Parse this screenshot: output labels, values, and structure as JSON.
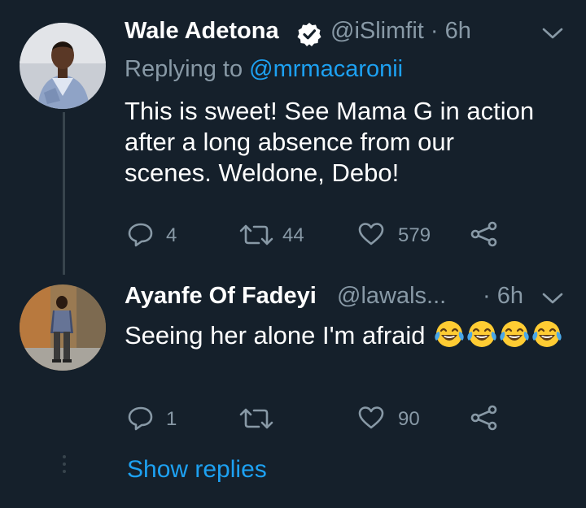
{
  "tweets": [
    {
      "name": "Wale Adetona",
      "verified": true,
      "handle": "@iSlimfit",
      "time": "· 6h",
      "replying_prefix": "Replying to",
      "replying_to": "@mrmacaronii",
      "text": "This is sweet! See Mama G in action after a long absence from our scenes. Weldone, Debo!",
      "replies": "4",
      "retweets": "44",
      "likes": "579"
    },
    {
      "name": "Ayanfe Of Fadeyi",
      "handle": "@lawals...",
      "time": "· 6h",
      "text": "Seeing her  alone I'm afraid",
      "emoji": "face-with-tears-of-joy-icon",
      "emoji_count": 4,
      "replies": "1",
      "retweets": "",
      "likes": "90"
    }
  ],
  "show_replies_label": "Show replies",
  "colors": {
    "background": "#15202b",
    "secondary_text": "#8899a6",
    "link": "#1da1f2",
    "thread_line": "#38444d"
  }
}
